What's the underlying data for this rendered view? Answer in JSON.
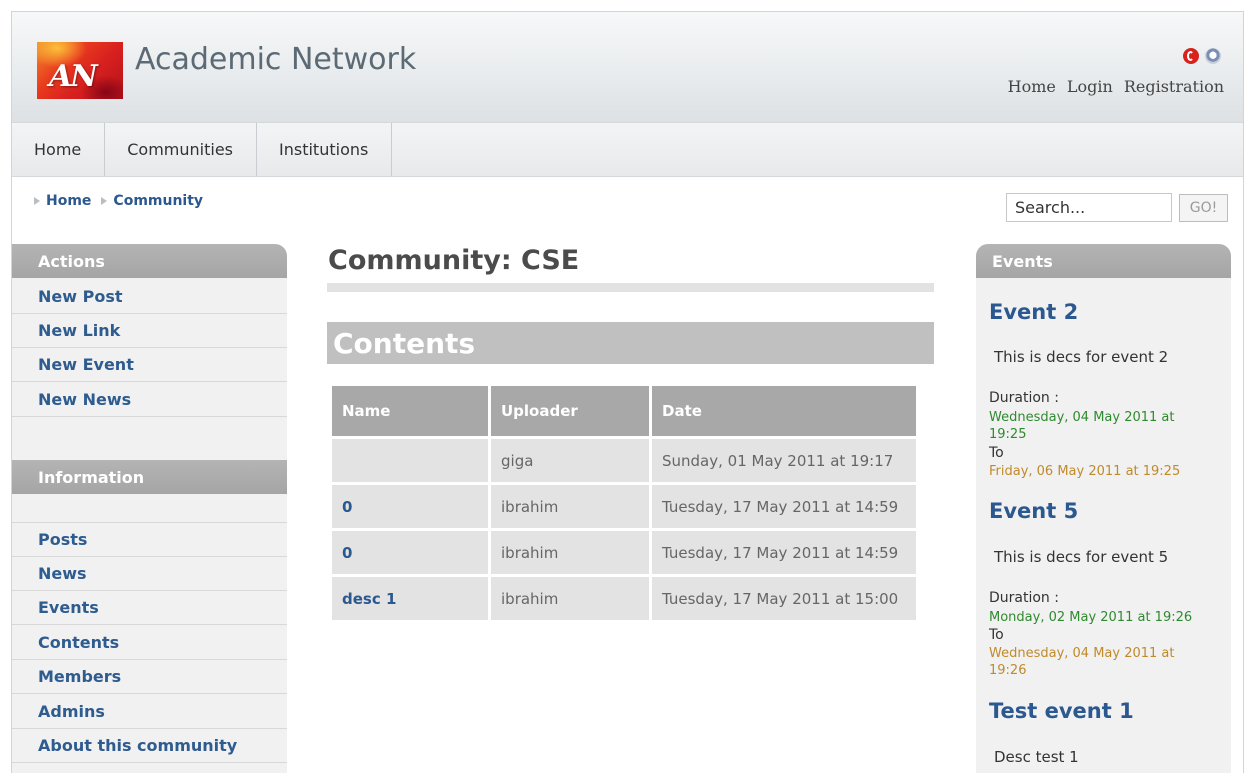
{
  "header": {
    "logo_text": "AN",
    "site_title": "Academic Network",
    "top_links": [
      "Home",
      "Login",
      "Registration"
    ]
  },
  "nav": {
    "items": [
      "Home",
      "Communities",
      "Institutions"
    ]
  },
  "breadcrumb": {
    "items": [
      "Home",
      "Community"
    ]
  },
  "search": {
    "value": "Search...",
    "button_label": "GO!"
  },
  "actions": {
    "title": "Actions",
    "items": [
      "New Post",
      "New Link",
      "New Event",
      "New News"
    ]
  },
  "information": {
    "title": "Information",
    "items": [
      "Posts",
      "News",
      "Events",
      "Contents",
      "Members",
      "Admins",
      "About this community"
    ]
  },
  "main": {
    "page_title": "Community: CSE",
    "section_title": "Contents",
    "table": {
      "headers": [
        "Name",
        "Uploader",
        "Date"
      ],
      "rows": [
        {
          "name": "",
          "uploader": "giga",
          "date": "Sunday, 01 May 2011 at 19:17"
        },
        {
          "name": "0",
          "uploader": "ibrahim",
          "date": "Tuesday, 17 May 2011 at 14:59"
        },
        {
          "name": "0",
          "uploader": "ibrahim",
          "date": "Tuesday, 17 May 2011 at 14:59"
        },
        {
          "name": "desc 1",
          "uploader": "ibrahim",
          "date": "Tuesday, 17 May 2011 at 15:00"
        }
      ]
    }
  },
  "events": {
    "title": "Events",
    "duration_label": "Duration :",
    "to_label": "To",
    "items": [
      {
        "title": "Event 2",
        "desc": "This is decs for event 2",
        "start": "Wednesday, 04 May 2011 at 19:25",
        "end": "Friday, 06 May 2011 at 19:25"
      },
      {
        "title": "Event 5",
        "desc": "This is decs for event 5",
        "start": "Monday, 02 May 2011 at 19:26",
        "end": "Wednesday, 04 May 2011 at 19:26"
      },
      {
        "title": "Test event 1",
        "desc": "Desc test 1"
      }
    ]
  },
  "colors": {
    "link_blue": "#2c5890",
    "box_header_gray": "#a8a8a8",
    "start_date_green": "#2f8a2f",
    "end_date_orange": "#c08a2a"
  }
}
